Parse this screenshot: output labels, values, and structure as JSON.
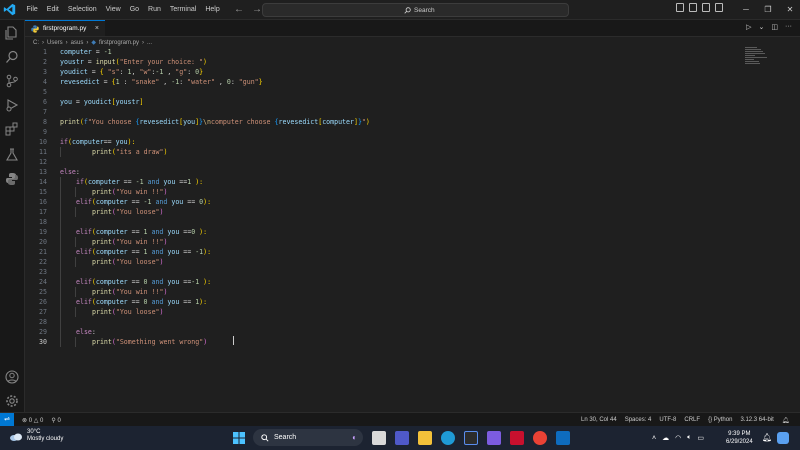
{
  "menus": [
    "File",
    "Edit",
    "Selection",
    "View",
    "Go",
    "Run",
    "Terminal",
    "Help"
  ],
  "search": {
    "label": "Search"
  },
  "tab": {
    "filename": "firstprogram.py",
    "close": "×"
  },
  "breadcrumb": [
    "C:",
    "Users",
    "asus",
    "firstprogram.py",
    "..."
  ],
  "code_lines": [
    {
      "n": "1"
    },
    {
      "n": "2"
    },
    {
      "n": "3"
    },
    {
      "n": "4"
    },
    {
      "n": "5"
    },
    {
      "n": "6"
    },
    {
      "n": "7"
    },
    {
      "n": "8"
    },
    {
      "n": "9"
    },
    {
      "n": "10"
    },
    {
      "n": "11"
    },
    {
      "n": "12"
    },
    {
      "n": "13"
    },
    {
      "n": "14"
    },
    {
      "n": "15"
    },
    {
      "n": "16"
    },
    {
      "n": "17"
    },
    {
      "n": "18"
    },
    {
      "n": "19"
    },
    {
      "n": "20"
    },
    {
      "n": "21"
    },
    {
      "n": "22"
    },
    {
      "n": "23"
    },
    {
      "n": "24"
    },
    {
      "n": "25"
    },
    {
      "n": "26"
    },
    {
      "n": "27"
    },
    {
      "n": "28"
    },
    {
      "n": "29"
    },
    {
      "n": "30"
    }
  ],
  "code": {
    "l1": [
      "computer",
      " = ",
      "-1"
    ],
    "l2": [
      "youstr",
      " = ",
      "input",
      "(",
      "\"Enter your choice: \"",
      ")"
    ],
    "l3": [
      "youdict",
      " = ",
      "{",
      " \"s\"",
      ": ",
      "1",
      ", ",
      "\"w\"",
      ":",
      "-1",
      " , ",
      "\"g\"",
      ": ",
      "0",
      "}"
    ],
    "l4": [
      "revesedict",
      " = ",
      "{",
      "1",
      " : ",
      "\"snake\"",
      " , ",
      "-1",
      ": ",
      "\"water\"",
      " , ",
      "0",
      ": ",
      "\"gun\"",
      "}"
    ],
    "l6": [
      "you",
      " = ",
      "youdict",
      "[",
      "youstr",
      "]"
    ],
    "l8": [
      "print",
      "(",
      "f",
      "\"You choose ",
      "{",
      "revesedict",
      "[",
      "you",
      "]",
      "}",
      "\\n",
      "computer choose ",
      "{",
      "revesedict",
      "[",
      "computer",
      "]",
      "}",
      "\"",
      ")"
    ],
    "l10": [
      "if",
      "(",
      "computer",
      "== ",
      "you",
      "):"
    ],
    "l11": [
      "print",
      "(",
      "\"its a draw\"",
      ")"
    ],
    "l13": [
      "else",
      ":"
    ],
    "l14": [
      "if",
      "(",
      "computer",
      " == ",
      "-1",
      " and ",
      "you",
      " ==",
      "1",
      " ):"
    ],
    "l15": [
      "print",
      "(",
      "\"You win !!\"",
      ")"
    ],
    "l16": [
      "elif",
      "(",
      "computer",
      " == ",
      "-1",
      " and ",
      "you",
      " == ",
      "0",
      "):"
    ],
    "l17": [
      "print",
      "(",
      "\"You loose\"",
      ")"
    ],
    "l19": [
      "elif",
      "(",
      "computer",
      " == ",
      "1",
      " and ",
      "you",
      " ==",
      "0",
      " ):"
    ],
    "l20": [
      "print",
      "(",
      "\"You win !!\"",
      ")"
    ],
    "l21": [
      "elif",
      "(",
      "computer",
      " == ",
      "1",
      " and ",
      "you",
      " == ",
      "-1",
      "):"
    ],
    "l22": [
      "print",
      "(",
      "\"You loose\"",
      ")"
    ],
    "l24": [
      "elif",
      "(",
      "computer",
      " == ",
      "0",
      " and ",
      "you",
      " ==",
      "-1",
      " ):"
    ],
    "l25": [
      "print",
      "(",
      "\"You win !!\"",
      ")"
    ],
    "l26": [
      "elif",
      "(",
      "computer",
      " == ",
      "0",
      " and ",
      "you",
      " == ",
      "1",
      "):"
    ],
    "l27": [
      "print",
      "(",
      "\"You loose\"",
      ")"
    ],
    "l29": [
      "else",
      ":"
    ],
    "l30": [
      "print",
      "(",
      "\"Something went wrong\"",
      ")"
    ]
  },
  "status": {
    "errors": "0",
    "warnings": "0",
    "ports": "0",
    "position": "Ln 30, Col 44",
    "spaces": "Spaces: 4",
    "encoding": "UTF-8",
    "eol": "CRLF",
    "language": "Python",
    "interpreter": "3.12.3 64-bit"
  },
  "weather": {
    "temp": "30°C",
    "desc": "Mostly cloudy"
  },
  "taskbar": {
    "search": "Search"
  },
  "clock": {
    "time": "9:39 PM",
    "date": "6/29/2024"
  },
  "colors": {
    "accent": "#0078d4",
    "editor_bg": "#1f1f1f",
    "keyword": "#c586c0",
    "string": "#ce9178",
    "variable": "#9cdcfe"
  }
}
